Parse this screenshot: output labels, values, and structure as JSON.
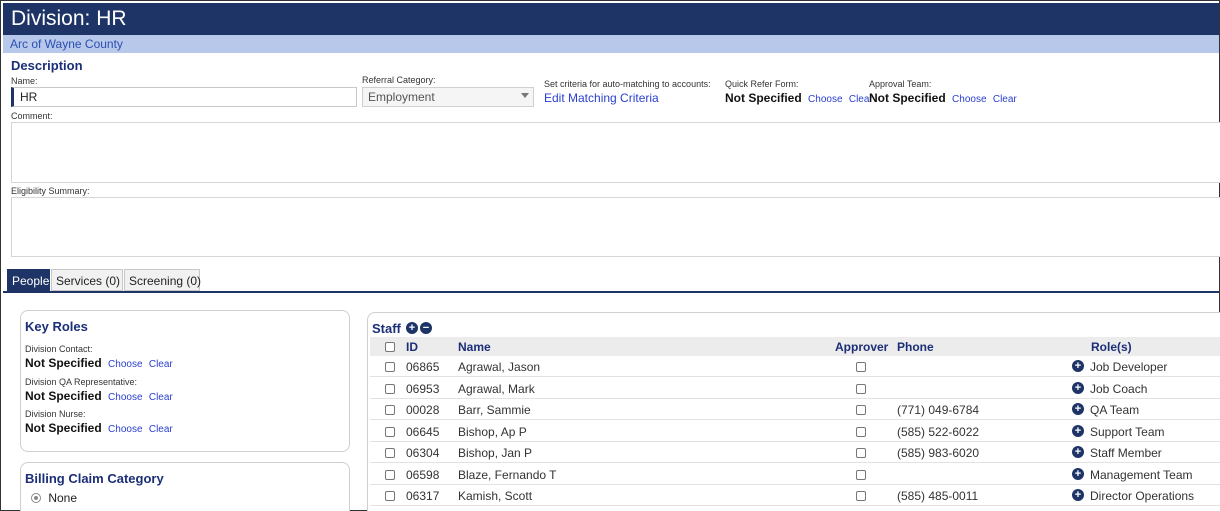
{
  "header": {
    "title": "Division: HR",
    "organization": "Arc of Wayne County"
  },
  "description": {
    "section_title": "Description",
    "name_label": "Name:",
    "name_value": "HR",
    "referral_label": "Referral Category:",
    "referral_value": "Employment",
    "matching_label": "Set criteria for auto-matching to accounts:",
    "matching_link": "Edit Matching Criteria",
    "quick_refer_label": "Quick Refer Form:",
    "quick_refer_value": "Not Specified",
    "approval_label": "Approval Team:",
    "approval_value": "Not Specified",
    "choose": "Choose",
    "clear": "Clear",
    "comment_label": "Comment:",
    "eligibility_label": "Eligibility Summary:"
  },
  "tabs": [
    "People",
    "Services (0)",
    "Screening (0)"
  ],
  "key_roles": {
    "title": "Key Roles",
    "roles": [
      {
        "label": "Division Contact:",
        "value": "Not Specified"
      },
      {
        "label": "Division QA Representative:",
        "value": "Not Specified"
      },
      {
        "label": "Division Nurse:",
        "value": "Not Specified"
      }
    ],
    "choose": "Choose",
    "clear": "Clear"
  },
  "billing": {
    "title": "Billing Claim Category",
    "option": "None"
  },
  "staff": {
    "title": "Staff",
    "columns": {
      "id": "ID",
      "name": "Name",
      "approver": "Approver",
      "phone": "Phone",
      "roles": "Role(s)"
    },
    "rows": [
      {
        "id": "06865",
        "name": "Agrawal, Jason",
        "phone": "",
        "role": "Job Developer"
      },
      {
        "id": "06953",
        "name": "Agrawal, Mark",
        "phone": "",
        "role": "Job Coach"
      },
      {
        "id": "00028",
        "name": "Barr, Sammie",
        "phone": "(771) 049-6784",
        "role": "QA Team"
      },
      {
        "id": "06645",
        "name": "Bishop, Ap P",
        "phone": "(585) 522-6022",
        "role": "Support Team"
      },
      {
        "id": "06304",
        "name": "Bishop, Jan P",
        "phone": "(585) 983-6020",
        "role": "Staff Member"
      },
      {
        "id": "06598",
        "name": "Blaze, Fernando T",
        "phone": "",
        "role": "Management Team"
      },
      {
        "id": "06317",
        "name": "Kamish, Scott",
        "phone": "(585) 485-0011",
        "role": "Director Operations"
      }
    ]
  },
  "colors": {
    "navy": "#1e3466",
    "light_blue": "#b8c8ea",
    "link": "#2a3fcf"
  }
}
